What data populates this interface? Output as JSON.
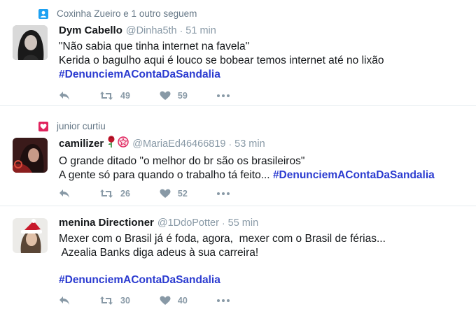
{
  "tweets": [
    {
      "context": "Coxinha Zueiro e 1 outro seguem",
      "name": "Dym Cabello",
      "handle": "@Dinha5th",
      "dot": "·",
      "time": "51 min",
      "line1": "\"Não sabia que tinha internet na favela\"",
      "line2": "Kerida o bagulho aqui é louco se bobear temos internet até no lixão",
      "hashtag": "#DenunciemAContaDaSandalia",
      "retweets": "49",
      "likes": "59"
    },
    {
      "context": "junior curtiu",
      "name": "camilizer",
      "handle": "@MariaEd46466819",
      "dot": "·",
      "time": "53 min",
      "line1": "O grande ditado \"o melhor do br são os brasileiros\"",
      "line2": "A gente só para quando o trabalho tá feito...",
      "hashtag": "#DenunciemAContaDaSandalia",
      "retweets": "26",
      "likes": "52"
    },
    {
      "name": "menina Directioner",
      "handle": "@1DdoPotter",
      "dot": "·",
      "time": "55 min",
      "line1": "Mexer com o Brasil já é foda, agora,  mexer com o Brasil de férias...",
      "line2": " Azealia Banks diga adeus à sua carreira!",
      "hashtag": "#DenunciemAContaDaSandalia",
      "retweets": "30",
      "likes": "40"
    }
  ],
  "colors": {
    "hashtag": "#2b3bd0",
    "follow_icon": "#1da1f2",
    "like_context_icon": "#e0245e",
    "meta_gray": "#8899a6"
  },
  "icons": [
    "person-icon",
    "heart-icon",
    "reply-icon",
    "retweet-icon",
    "like-icon",
    "more-icon",
    "rose-emoji",
    "badge-emoji"
  ]
}
